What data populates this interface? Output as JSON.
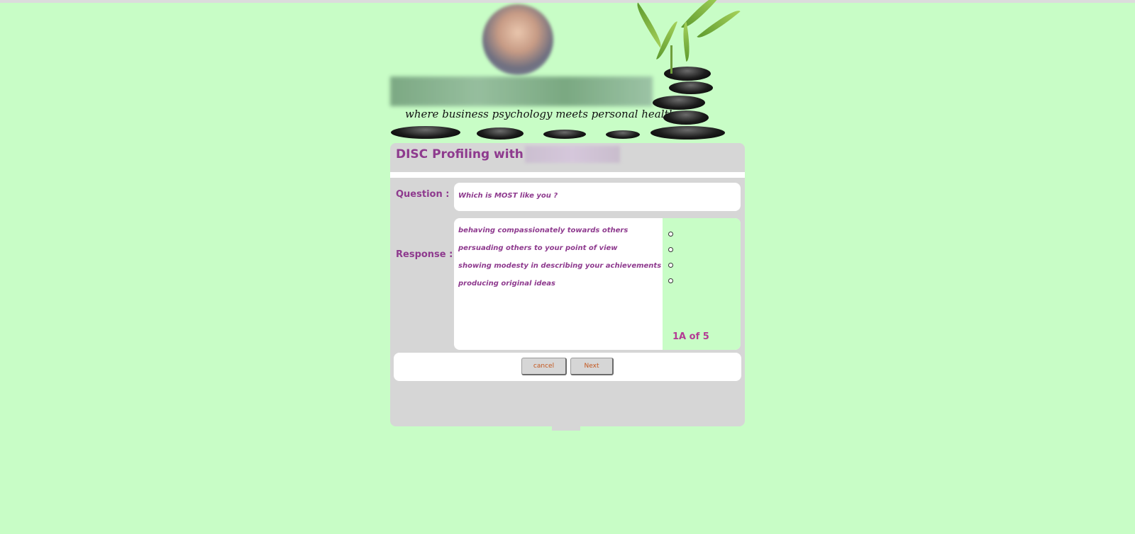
{
  "header": {
    "tagline": "where business psychology meets personal health"
  },
  "panel": {
    "title": "DISC Profiling with",
    "question_label": "Question :",
    "question_text": "Which is MOST like you ?",
    "response_label": "Response :",
    "options": [
      "behaving compassionately towards others",
      "persuading others to your point of view",
      "showing modesty in describing your achievements",
      "producing original ideas"
    ],
    "progress": "1A of 5"
  },
  "buttons": {
    "cancel_label": "cancel",
    "next_label": "Next"
  },
  "colors": {
    "background": "#c8fdc6",
    "panel": "#d6d6d6",
    "accent": "#8e3a8e",
    "progress": "#b33a94",
    "button_text": "#c4561d"
  },
  "icons": [
    "radio-icon"
  ]
}
